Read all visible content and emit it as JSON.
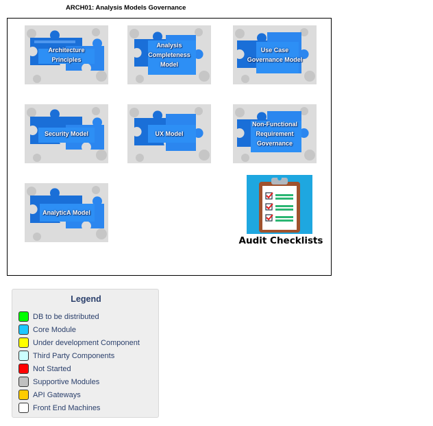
{
  "page": {
    "title": "ARCH01: Analysis Models Governance"
  },
  "tiles": [
    {
      "id": "architecture-principles",
      "label": "Architecture Principles"
    },
    {
      "id": "analysis-completeness-model",
      "label": "Analysis Completeness Model"
    },
    {
      "id": "use-case-governance-model",
      "label": "Use Case Governance Model"
    },
    {
      "id": "security-model",
      "label": "Security Model"
    },
    {
      "id": "ux-model",
      "label": "UX Model"
    },
    {
      "id": "non-functional-requirement-governance",
      "label": "Non-Functional Requirement Governance"
    },
    {
      "id": "analytica-model",
      "label": "AnalyticA Model"
    }
  ],
  "audit": {
    "label": "Audit Checklists",
    "icon": "clipboard-checklist-icon"
  },
  "legend": {
    "title": "Legend",
    "items": [
      {
        "label": "DB to be distributed",
        "color": "#00ff00"
      },
      {
        "label": "Core Module",
        "color": "#1ec8ff"
      },
      {
        "label": "Under development Component",
        "color": "#ffff00"
      },
      {
        "label": "Third Party Components",
        "color": "#ccffff"
      },
      {
        "label": "Not Started",
        "color": "#ff0000"
      },
      {
        "label": "Supportive Modules",
        "color": "#c0c0c0"
      },
      {
        "label": "API Gateways",
        "color": "#ffcc00"
      },
      {
        "label": "Front End Machines",
        "color": "#ffffff"
      }
    ]
  },
  "colors": {
    "puzzle_blue": "#1a6fd8",
    "puzzle_background": "#d9d9d9",
    "clipboard_board": "#a0522d",
    "clipboard_background": "#1ea7e0",
    "legend_text": "#2a3f6b"
  }
}
